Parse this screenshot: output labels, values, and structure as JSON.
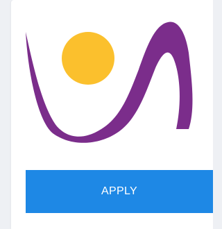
{
  "logo": {
    "icon": "wave-logo-icon",
    "sun_color": "#fbc02d",
    "wave_color": "#7b2d8b"
  },
  "actions": {
    "apply_label": "APPLY",
    "apply_color": "#1e88e5"
  }
}
